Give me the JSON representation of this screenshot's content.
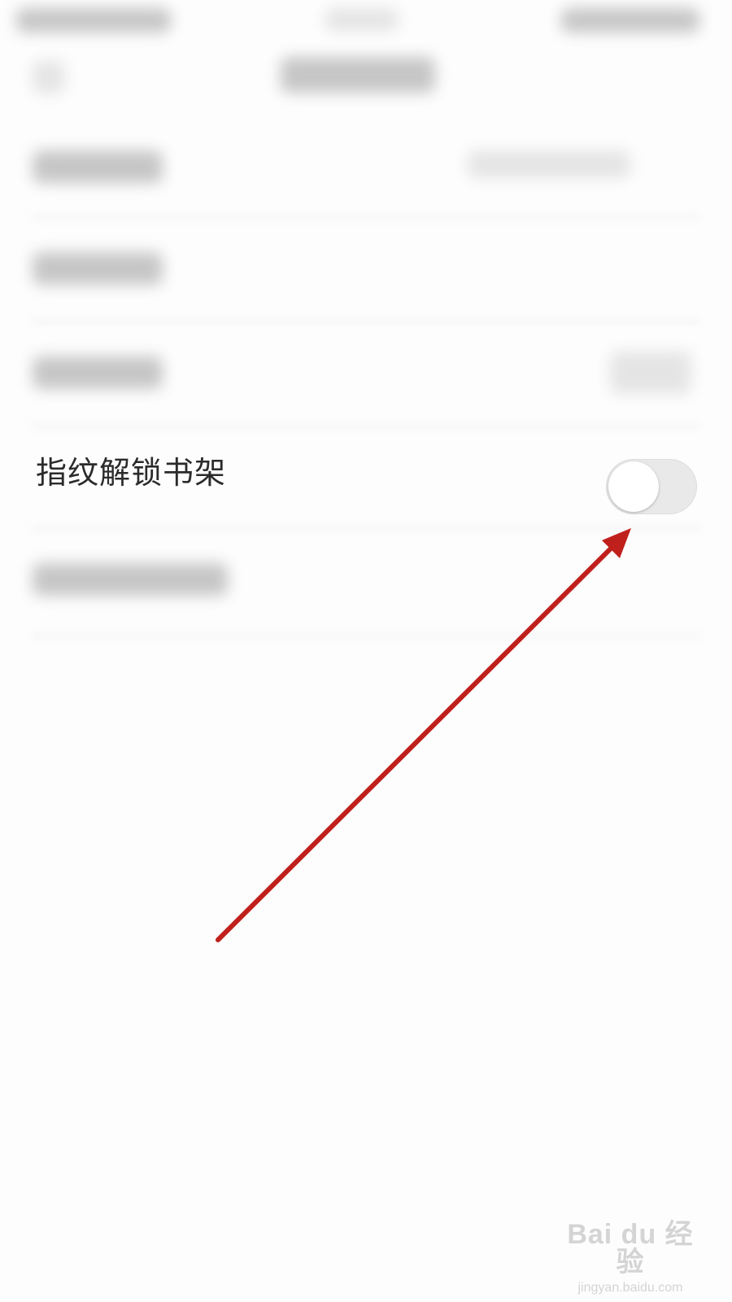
{
  "setting": {
    "label": "指纹解锁书架",
    "enabled": false
  },
  "watermark": {
    "logo_text": "Bai du 经验",
    "url": "jingyan.baidu.com"
  },
  "colors": {
    "background": "#fdfdfd",
    "label": "#2b2b2b",
    "toggle_track": "#e9e9e9",
    "toggle_knob": "#ffffff",
    "arrow": "#c0201c",
    "watermark": "#d4d4d4"
  }
}
